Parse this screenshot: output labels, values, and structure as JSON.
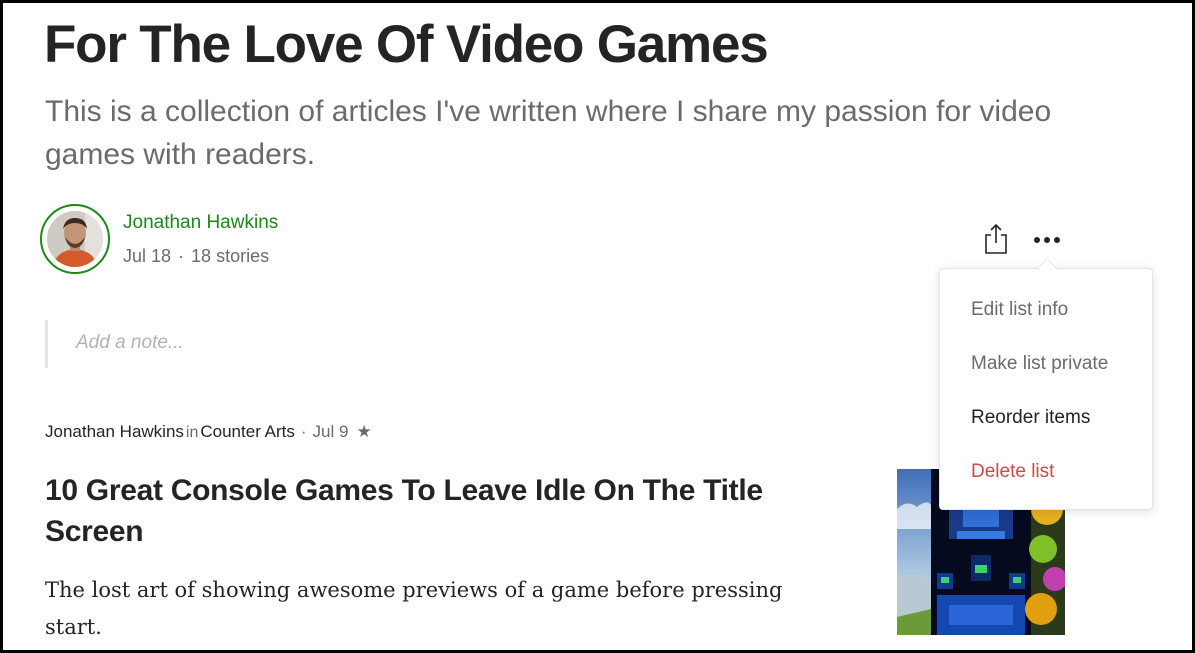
{
  "list": {
    "title": "For The Love Of Video Games",
    "description": "This is a collection of articles I've written where I share my passion for video games with readers.",
    "author": "Jonathan Hawkins",
    "date": "Jul 18",
    "story_count": "18 stories",
    "dot": "·",
    "note_placeholder": "Add a note..."
  },
  "actions": {
    "share_icon": "share-icon",
    "more_icon": "more-icon"
  },
  "menu": {
    "items": [
      {
        "label": "Edit list info"
      },
      {
        "label": "Make list private"
      },
      {
        "label": "Reorder items"
      },
      {
        "label": "Delete list"
      }
    ]
  },
  "article": {
    "author": "Jonathan Hawkins",
    "in": "in",
    "publication": "Counter Arts",
    "dot": "·",
    "date": "Jul 9",
    "star": "★",
    "title": "10 Great Console Games To Leave Idle On The Title Screen",
    "subtitle": "The lost art of showing awesome previews of a game before pressing start."
  },
  "colors": {
    "accent_green": "#1a8917",
    "danger_red": "#c94a4a",
    "text_primary": "#242424",
    "text_secondary": "#6b6b6b"
  }
}
